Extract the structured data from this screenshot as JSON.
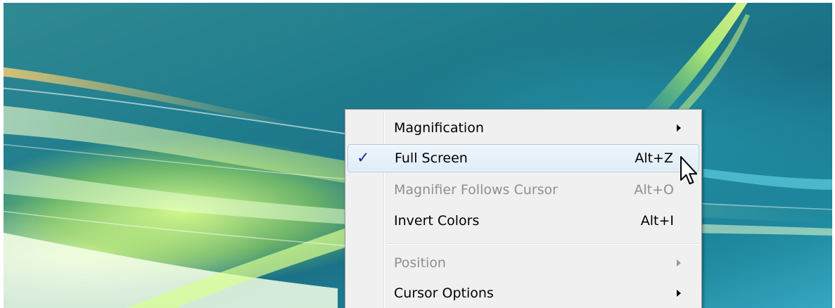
{
  "desktop": {
    "background": "Windows Vista aurora wallpaper"
  },
  "context_menu": {
    "items": [
      {
        "label": "Magnification",
        "shortcut": "",
        "checked": false,
        "disabled": false,
        "has_submenu": true
      },
      {
        "label": "Full Screen",
        "shortcut": "Alt+Z",
        "checked": true,
        "disabled": false,
        "has_submenu": false,
        "highlighted": true
      },
      {
        "label": "Magnifier Follows Cursor",
        "shortcut": "Alt+O",
        "checked": false,
        "disabled": true,
        "has_submenu": false
      },
      {
        "label": "Invert Colors",
        "shortcut": "Alt+I",
        "checked": false,
        "disabled": false,
        "has_submenu": false
      },
      {
        "label": "Position",
        "shortcut": "",
        "checked": false,
        "disabled": true,
        "has_submenu": true
      },
      {
        "label": "Cursor Options",
        "shortcut": "",
        "checked": false,
        "disabled": false,
        "has_submenu": true
      }
    ],
    "check_glyph": "✓",
    "colors": {
      "menu_bg": "#f0f0f0",
      "highlight_border": "#a9c7e4",
      "check": "#1a2f9c",
      "disabled_text": "#8f8f8f"
    }
  },
  "icons": {
    "submenu": "submenu-arrow-icon",
    "check": "check-icon",
    "pointer": "mouse-pointer-icon"
  }
}
